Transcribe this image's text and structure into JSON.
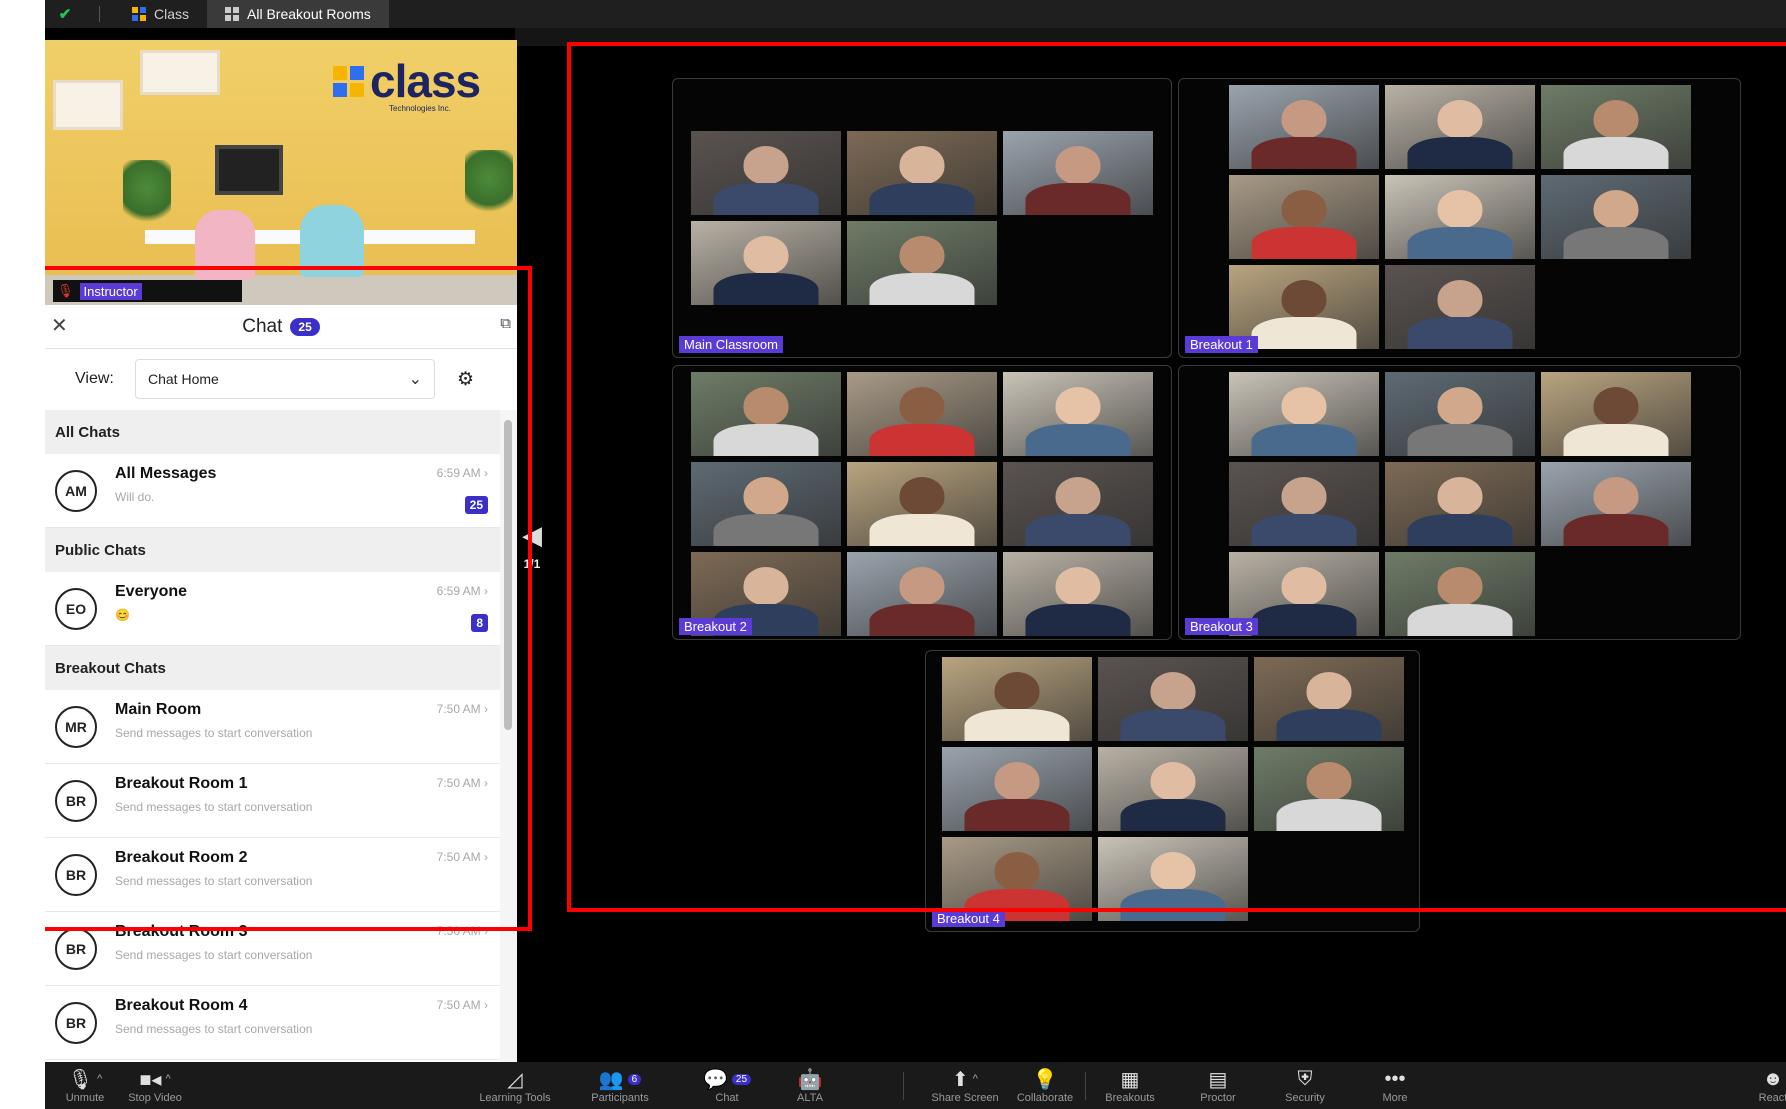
{
  "tabs": [
    {
      "label": "Class"
    },
    {
      "label": "All Breakout Rooms"
    }
  ],
  "instructor": {
    "logo_word": "class",
    "logo_sub": "Technologies Inc.",
    "name_label": "Instructor"
  },
  "chat": {
    "title": "Chat",
    "count": "25",
    "view_label": "View:",
    "view_value": "Chat Home",
    "sections": [
      {
        "title": "All Chats",
        "items": [
          {
            "initials": "AM",
            "name": "All Messages",
            "preview": "Will do.",
            "time": "6:59 AM ›",
            "count": "25"
          }
        ]
      },
      {
        "title": "Public Chats",
        "items": [
          {
            "initials": "EO",
            "name": "Everyone",
            "preview": "😊",
            "time": "6:59 AM ›",
            "count": "8"
          }
        ]
      },
      {
        "title": "Breakout Chats",
        "items": [
          {
            "initials": "MR",
            "name": "Main Room",
            "preview": "Send messages to start conversation",
            "time": "7:50 AM ›",
            "count": ""
          },
          {
            "initials": "BR",
            "name": "Breakout Room 1",
            "preview": "Send messages to start conversation",
            "time": "7:50 AM ›",
            "count": ""
          },
          {
            "initials": "BR",
            "name": "Breakout Room 2",
            "preview": "Send messages to start conversation",
            "time": "7:50 AM ›",
            "count": ""
          },
          {
            "initials": "BR",
            "name": "Breakout Room 3",
            "preview": "Send messages to start conversation",
            "time": "7:50 AM ›",
            "count": ""
          },
          {
            "initials": "BR",
            "name": "Breakout Room 4",
            "preview": "Send messages to start conversation",
            "time": "7:50 AM ›",
            "count": ""
          }
        ]
      }
    ]
  },
  "pager": {
    "text": "1/1"
  },
  "rooms": [
    {
      "label": "Main Classroom",
      "participants": 5
    },
    {
      "label": "Breakout 1",
      "participants": 8
    },
    {
      "label": "Breakout 2",
      "participants": 9
    },
    {
      "label": "Breakout 3",
      "participants": 8
    },
    {
      "label": "Breakout 4",
      "participants": 8
    }
  ],
  "toolbar": [
    {
      "label": "Unmute",
      "icon": "mic-muted-icon",
      "glyph": "🎙",
      "caret": true,
      "badge": ""
    },
    {
      "label": "Stop Video",
      "icon": "video-camera-icon",
      "glyph": "■◂",
      "caret": true,
      "badge": ""
    },
    {
      "label": "Learning Tools",
      "icon": "learning-tools-icon",
      "glyph": "◿",
      "caret": false,
      "badge": ""
    },
    {
      "label": "Participants",
      "icon": "participants-icon",
      "glyph": "👥",
      "caret": false,
      "badge": "6"
    },
    {
      "label": "Chat",
      "icon": "chat-icon",
      "glyph": "💬",
      "caret": false,
      "badge": "25"
    },
    {
      "label": "ALTA",
      "icon": "alta-robot-icon",
      "glyph": "🤖",
      "caret": false,
      "badge": ""
    },
    {
      "label": "Share Screen",
      "icon": "share-screen-icon",
      "glyph": "⬆",
      "caret": true,
      "badge": ""
    },
    {
      "label": "Collaborate",
      "icon": "lightbulb-icon",
      "glyph": "💡",
      "caret": false,
      "badge": ""
    },
    {
      "label": "Breakouts",
      "icon": "breakouts-grid-icon",
      "glyph": "▦",
      "caret": false,
      "badge": ""
    },
    {
      "label": "Proctor",
      "icon": "proctor-icon",
      "glyph": "▤",
      "caret": false,
      "badge": ""
    },
    {
      "label": "Security",
      "icon": "shield-icon",
      "glyph": "⛨",
      "caret": false,
      "badge": ""
    },
    {
      "label": "More",
      "icon": "more-dots-icon",
      "glyph": "•••",
      "caret": false,
      "badge": ""
    },
    {
      "label": "React",
      "icon": "smiley-icon",
      "glyph": "☻",
      "caret": false,
      "badge": ""
    }
  ],
  "colors": {
    "accent": "#3b2fc9",
    "label_purple": "#5b3bd6",
    "highlight": "#ff0000"
  }
}
